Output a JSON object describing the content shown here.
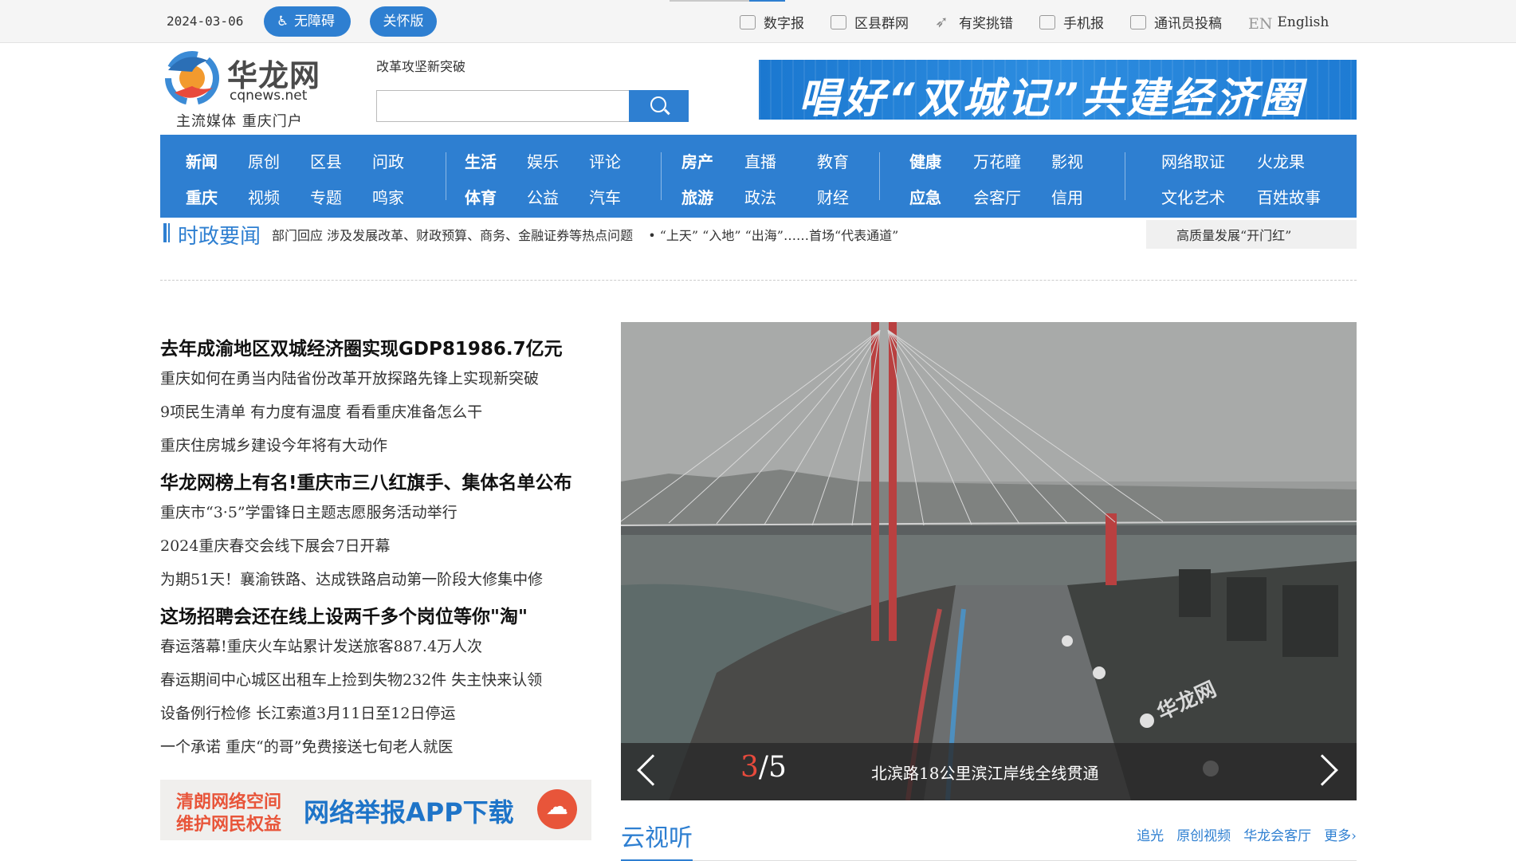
{
  "topbar": {
    "date": "2024-03-06",
    "accessibility_label": "无障碍",
    "care_label": "关怀版",
    "links": [
      {
        "label": "数字报",
        "icon": "newspaper-icon"
      },
      {
        "label": "区县群网",
        "icon": "copy-icon"
      },
      {
        "label": "有奖挑错",
        "icon": "send-icon"
      },
      {
        "label": "手机报",
        "icon": "phone-icon"
      },
      {
        "label": "通讯员投稿",
        "icon": "document-icon"
      },
      {
        "label": "English",
        "icon": "en-icon"
      }
    ]
  },
  "header": {
    "logo_cn": "华龙网",
    "logo_en": "cqnews.net",
    "slogan": "主流媒体  重庆门户",
    "search_hint": "改革攻坚新突破",
    "search_value": "",
    "banner_text": "唱好“双城记”共建经济圈"
  },
  "nav": {
    "items": [
      "新闻",
      "原创",
      "区县",
      "问政",
      "重庆",
      "视频",
      "专题",
      "鸣家",
      "生活",
      "娱乐",
      "评论",
      "体育",
      "公益",
      "汽车",
      "房产",
      "直播",
      "教育",
      "旅游",
      "政法",
      "财经",
      "健康",
      "万花瞳",
      "影视",
      "应急",
      "会客厅",
      "信用",
      "网络取证",
      "火龙果",
      "文化艺术",
      "百姓故事"
    ]
  },
  "ticker": {
    "title": "时政要闻",
    "items": [
      "部门回应 涉及发展改革、财政预算、商务、金融证券等热点问题",
      "• “上天” “入地” “出海”……首场“代表通道”"
    ],
    "right_text": "高质量发展“开门红”"
  },
  "news": [
    {
      "text": "去年成渝地区双城经济圈实现GDP81986.7亿元",
      "head": true
    },
    {
      "text": "重庆如何在勇当内陆省份改革开放探路先锋上实现新突破",
      "head": false
    },
    {
      "text": "9项民生清单  有力度有温度  看看重庆准备怎么干",
      "head": false
    },
    {
      "text": "重庆住房城乡建设今年将有大动作",
      "head": false
    },
    {
      "text": "华龙网榜上有名!重庆市三八红旗手、集体名单公布",
      "head": true
    },
    {
      "text": "重庆市“3·5”学雷锋日主题志愿服务活动举行",
      "head": false
    },
    {
      "text": "2024重庆春交会线下展会7日开幕",
      "head": false
    },
    {
      "text": "为期51天！襄渝铁路、达成铁路启动第一阶段大修集中修",
      "head": false
    },
    {
      "text": "这场招聘会还在线上设两千多个岗位等你\"淘\"",
      "head": true
    },
    {
      "text": "春运落幕!重庆火车站累计发送旅客887.4万人次",
      "head": false
    },
    {
      "text": "春运期间中心城区出租车上捡到失物232件  失主快来认领",
      "head": false
    },
    {
      "text": "设备例行检修  长江索道3月11日至12日停运",
      "head": false
    },
    {
      "text": "一个承诺  重庆“的哥”免费接送七旬老人就医",
      "head": false
    }
  ],
  "ad": {
    "line1": "清朗网络空间",
    "line2": "维护网民权益",
    "big": "网络举报APP下载"
  },
  "slideshow": {
    "current": "3",
    "total": "/5",
    "caption": "北滨路18公里滨江岸线全线贯通",
    "watermark": "华龙网"
  },
  "section": {
    "title": "云视听",
    "links": [
      "追光",
      "原创视频",
      "华龙会客厅",
      "更多›"
    ]
  },
  "colors": {
    "accent": "#2e7fd1",
    "highlight": "#e84a3c"
  }
}
